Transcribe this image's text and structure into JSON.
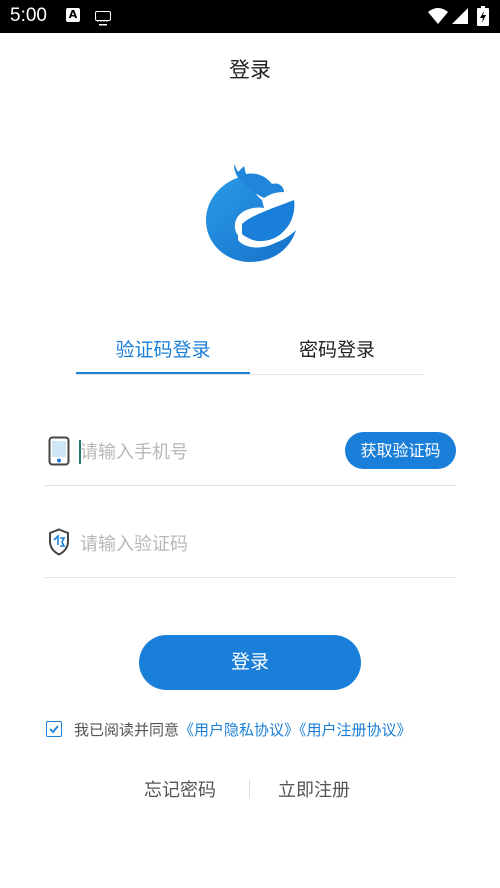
{
  "status_bar": {
    "time": "5:00",
    "a_icon": "A",
    "icons": [
      "a-notification-icon",
      "keyboard-icon",
      "wifi-icon",
      "signal-icon",
      "battery-icon"
    ]
  },
  "page": {
    "title": "登录"
  },
  "tabs": [
    {
      "label": "验证码登录",
      "active": true
    },
    {
      "label": "密码登录",
      "active": false
    }
  ],
  "form": {
    "phone_placeholder": "请输入手机号",
    "get_code_label": "获取验证码",
    "code_placeholder": "请输入验证码",
    "login_label": "登录"
  },
  "agreement": {
    "checked": true,
    "prefix": "我已阅读并同意",
    "privacy_link": "《用户隐私协议》",
    "register_link": "《用户注册协议》"
  },
  "links": {
    "forgot_password": "忘记密码",
    "register_now": "立即注册"
  },
  "colors": {
    "accent": "#1a7fd8",
    "status_bar": "#000000",
    "text": "#222222",
    "placeholder": "#b7b7b7"
  }
}
